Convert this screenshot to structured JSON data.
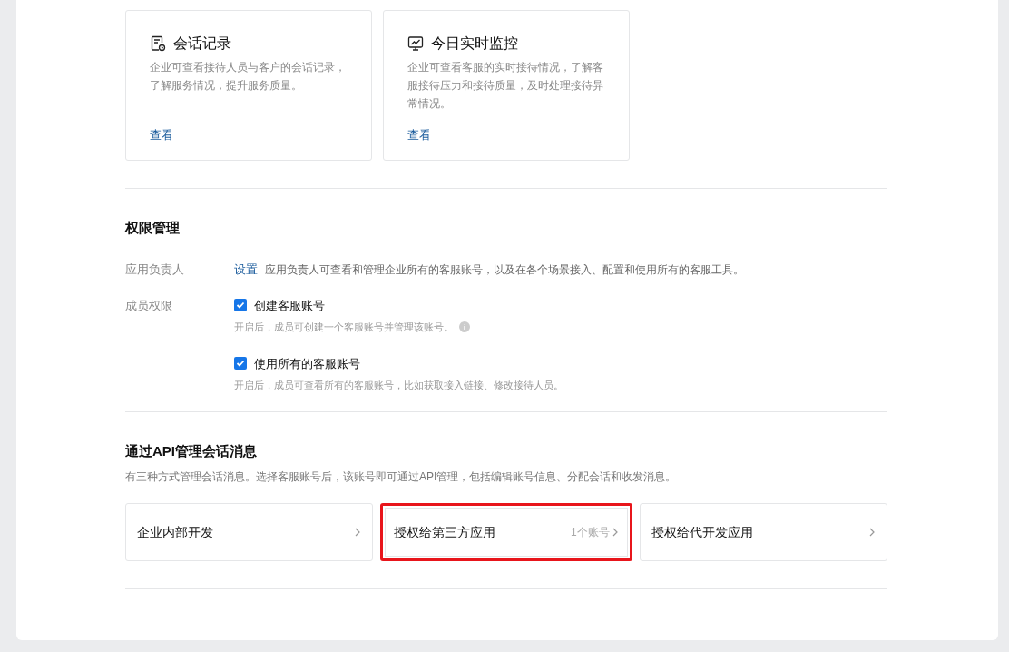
{
  "feature_cards": [
    {
      "kind": "record",
      "title": "会话记录",
      "description": "企业可查看接待人员与客户的会话记录，了解服务情况，提升服务质量。",
      "link": "查看"
    },
    {
      "kind": "monitor",
      "title": "今日实时监控",
      "description": "企业可查看客服的实时接待情况，了解客服接待压力和接待质量，及时处理接待异常情况。",
      "link": "查看"
    }
  ],
  "permissions": {
    "title": "权限管理",
    "owner": {
      "label": "应用负责人",
      "link": "设置",
      "description": "应用负责人可查看和管理企业所有的客服账号，以及在各个场景接入、配置和使用所有的客服工具。"
    },
    "members": {
      "label": "成员权限",
      "options": [
        {
          "label": "创建客服账号",
          "checked": true,
          "hint": "开启后，成员可创建一个客服账号并管理该账号。",
          "info": true
        },
        {
          "label": "使用所有的客服账号",
          "checked": true,
          "hint": "开启后，成员可查看所有的客服账号，比如获取接入链接、修改接待人员。",
          "info": false
        }
      ]
    }
  },
  "api": {
    "title": "通过API管理会话消息",
    "description": "有三种方式管理会话消息。选择客服账号后，该账号即可通过API管理，包括编辑账号信息、分配会话和收发消息。",
    "options": [
      {
        "label": "企业内部开发",
        "highlighted": false
      },
      {
        "label": "授权给第三方应用",
        "count": "1个账号",
        "highlighted": true
      },
      {
        "label": "授权给代开发应用",
        "highlighted": false
      }
    ]
  }
}
